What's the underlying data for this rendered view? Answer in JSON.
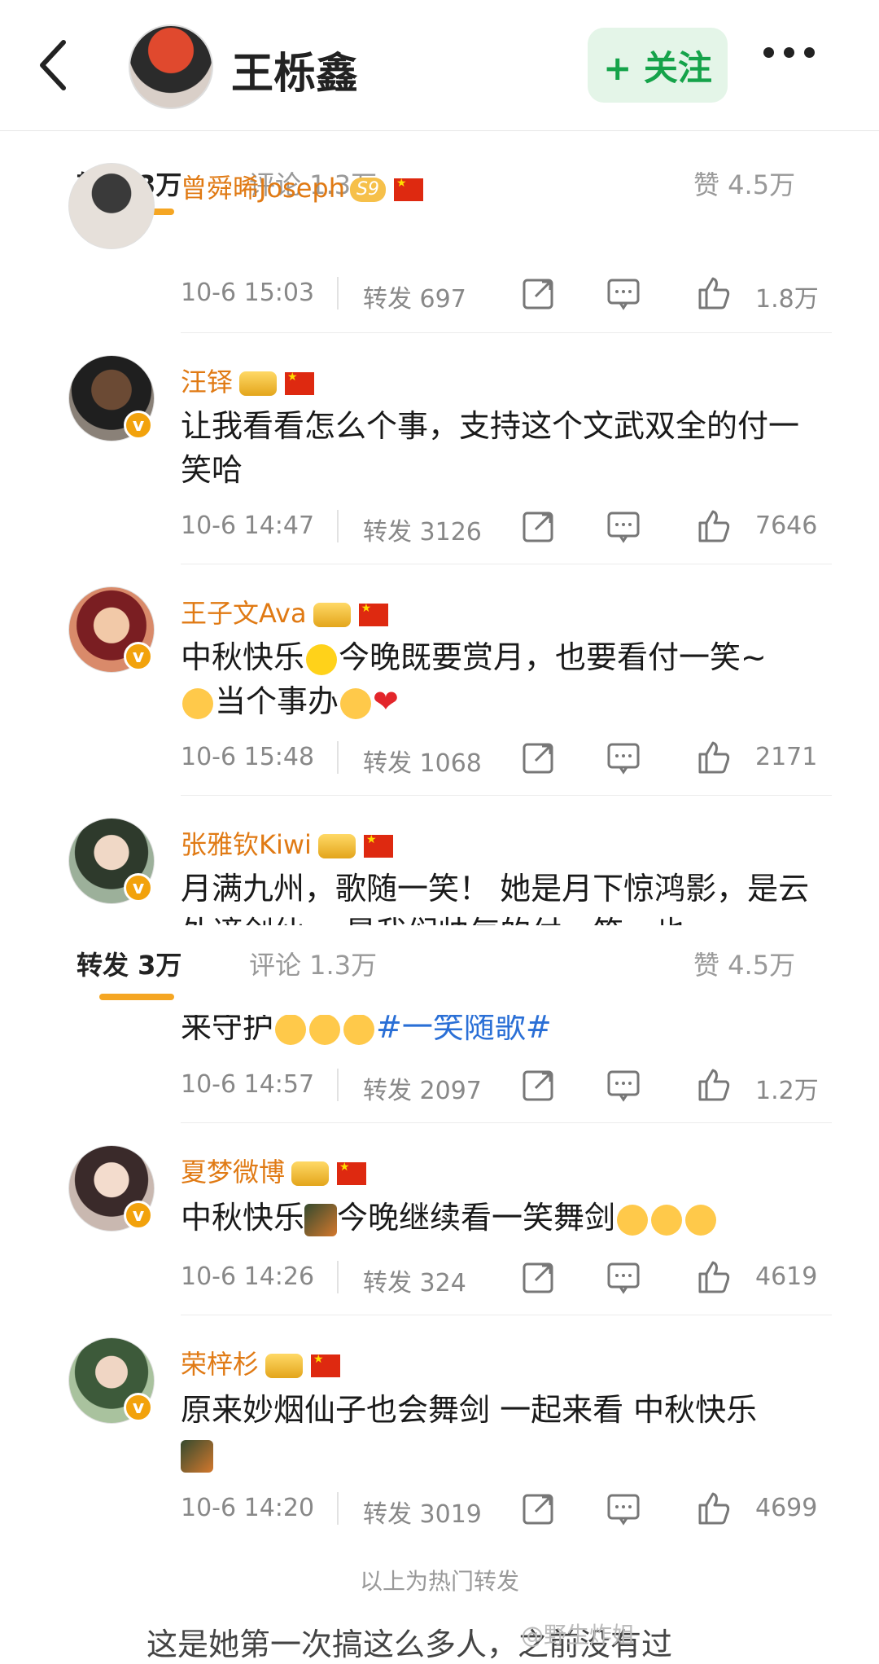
{
  "header": {
    "title": "王栎鑫",
    "follow_label": "+ 关注"
  },
  "tabs": {
    "repost": "转发 3万",
    "comment": "评论 1.3万",
    "like": "赞 4.5万"
  },
  "comments": [
    {
      "name": "曾舜晞Joseph",
      "level": "S9",
      "text": "",
      "time": "10-6 15:03",
      "repost": "转发 697",
      "likes": "1.8万"
    },
    {
      "name": "汪铎",
      "text": "让我看看怎么个事，支持这个文武双全的付一笑哈",
      "time": "10-6 14:47",
      "repost": "转发 3126",
      "likes": "7646"
    },
    {
      "name": "王子文Ava",
      "text_1": "中秋快乐",
      "text_2": "今晚既要赏月，也要看付一笑~",
      "text_3": "当个事办",
      "time": "10-6 15:48",
      "repost": "转发 1068",
      "likes": "2171"
    },
    {
      "name": "张雅钦Kiwi",
      "text": "月满九州，歌随一笑！ 她是月下惊鸿影，是云外谪剑仙。 是我们帅气的付一笑，也",
      "text_cont": "来守护",
      "hashtag": "#一笑随歌#",
      "time": "10-6 14:57",
      "repost": "转发 2097",
      "likes": "1.2万"
    },
    {
      "name": "夏梦微博",
      "text_1": "中秋快乐",
      "text_2": "今晚继续看一笑舞剑",
      "time": "10-6 14:26",
      "repost": "转发 324",
      "likes": "4619"
    },
    {
      "name": "荣梓杉",
      "text": "原来妙烟仙子也会舞剑 一起来看 中秋快乐",
      "time": "10-6 14:20",
      "repost": "转发 3019",
      "likes": "4699"
    }
  ],
  "footer_note": "以上为热门转发",
  "bottom_text": "这是她第一次搞这么多人，之前没有过",
  "watermark": "@野生炸姐"
}
